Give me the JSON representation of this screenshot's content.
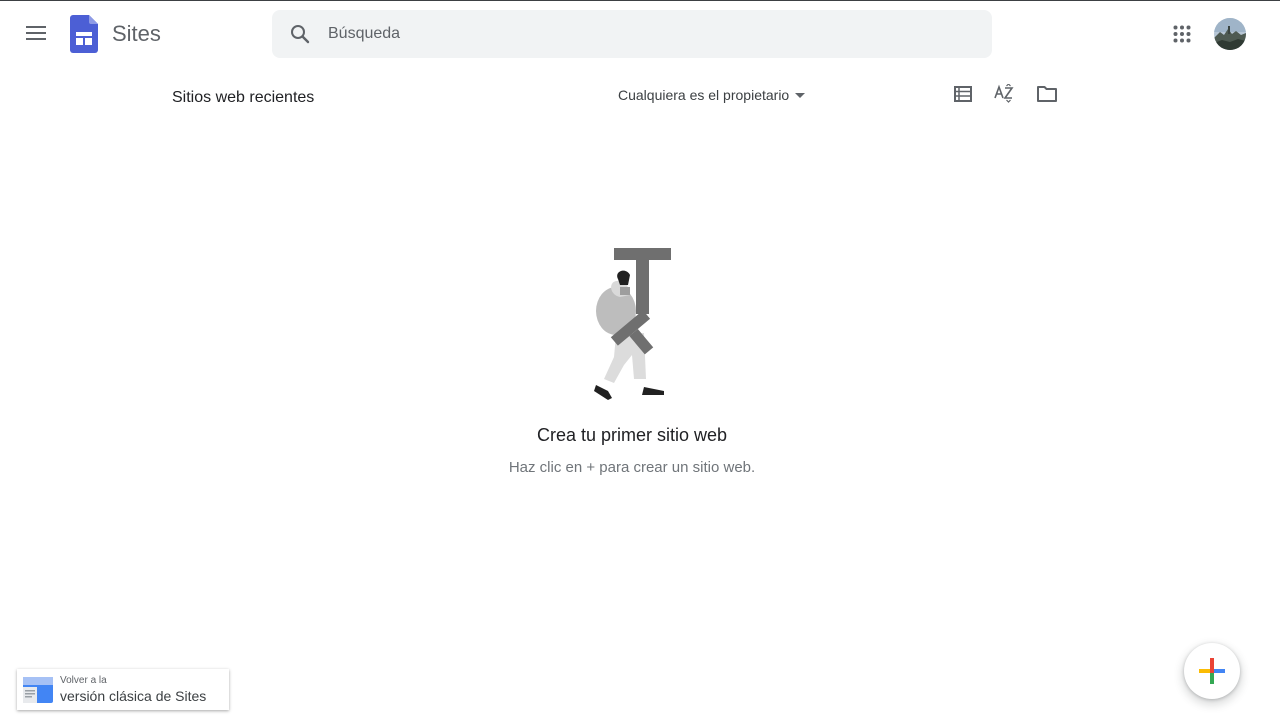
{
  "app": {
    "name": "Sites"
  },
  "search": {
    "placeholder": "Búsqueda",
    "value": ""
  },
  "toolbar": {
    "title": "Sitios web recientes",
    "owner_filter": "Cualquiera es el propietario"
  },
  "empty_state": {
    "title": "Crea tu primer sitio web",
    "subtitle": "Haz clic en + para crear un sitio web."
  },
  "classic_link": {
    "line1": "Volver a la",
    "line2": "versión clásica de Sites"
  },
  "icons": {
    "menu": "menu-icon",
    "logo": "google-sites-logo",
    "search": "search-icon",
    "apps": "apps-grid-icon",
    "avatar": "user-avatar",
    "list_view": "list-view-icon",
    "sort": "sort-az-icon",
    "folder": "folder-icon",
    "fab": "plus-icon"
  },
  "colors": {
    "brand_blue": "#4c5fd5",
    "plus_red": "#ea4335",
    "plus_blue": "#4285f4",
    "plus_green": "#34a853",
    "plus_yellow": "#fbbc04"
  }
}
